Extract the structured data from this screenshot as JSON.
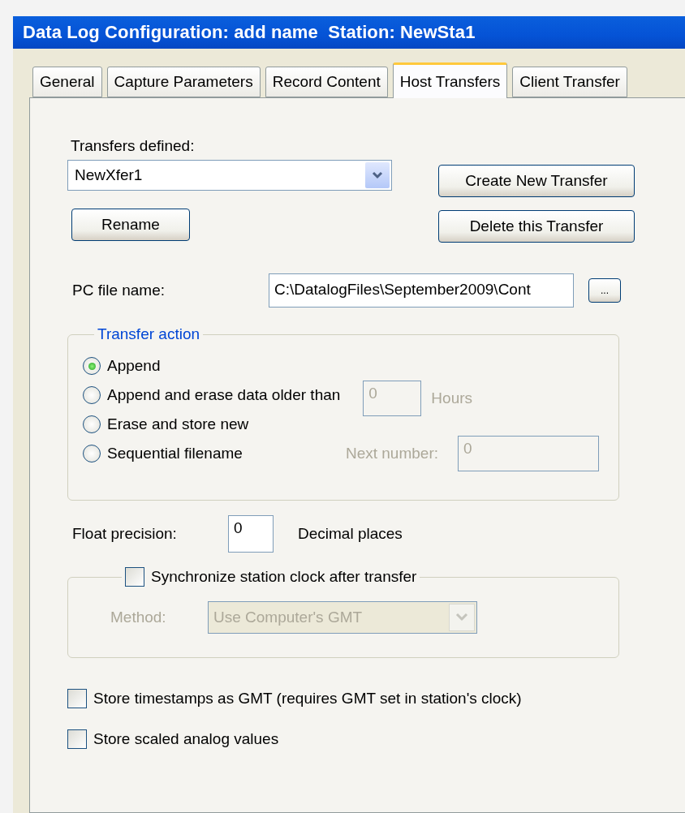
{
  "window": {
    "title": "Data Log Configuration: add name  Station: NewSta1"
  },
  "tabs": [
    {
      "label": "General",
      "selected": false
    },
    {
      "label": "Capture Parameters",
      "selected": false
    },
    {
      "label": "Record Content",
      "selected": false
    },
    {
      "label": "Host Transfers",
      "selected": true
    },
    {
      "label": "Client Transfer",
      "selected": false
    }
  ],
  "transfers": {
    "label": "Transfers defined:",
    "value": "NewXfer1",
    "buttons": [
      "Create New Transfer",
      "Rename",
      "Delete this Transfer"
    ]
  },
  "pc_file": {
    "label": "PC file name:",
    "value": "C:\\DatalogFiles\\September2009\\Cont",
    "browse_label": "..."
  },
  "transfer_action": {
    "legend": "Transfer action",
    "options": [
      {
        "label": "Append",
        "selected": true
      },
      {
        "label": "Append and erase data older than",
        "selected": false,
        "field": {
          "value": "0",
          "suffix": "Hours",
          "disabled": true
        }
      },
      {
        "label": "Erase and store new",
        "selected": false
      },
      {
        "label": "Sequential filename",
        "selected": false,
        "field": {
          "prefix": "Next number:",
          "value": "0",
          "disabled": true
        }
      }
    ]
  },
  "float_precision": {
    "label": "Float precision:",
    "value": "0",
    "suffix": "Decimal places"
  },
  "sync": {
    "label": "Synchronize station clock after transfer",
    "checked": false,
    "method_label": "Method:",
    "method_value": "Use Computer's GMT",
    "disabled": true
  },
  "options": [
    {
      "label": "Store timestamps as GMT (requires GMT set in station's clock)",
      "checked": false
    },
    {
      "label": "Store scaled analog values",
      "checked": false
    }
  ]
}
